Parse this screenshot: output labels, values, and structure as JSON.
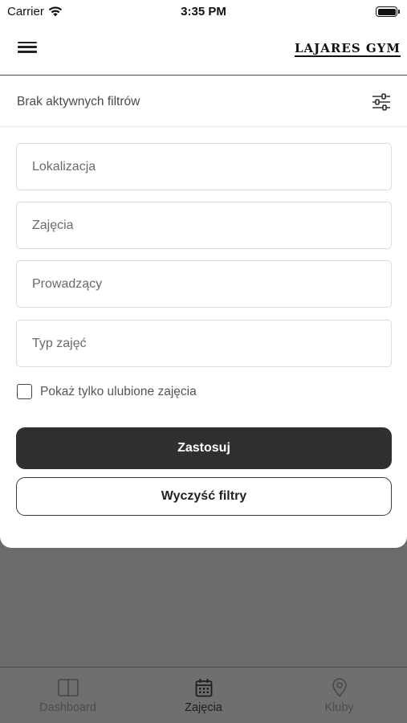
{
  "status_bar": {
    "carrier": "Carrier",
    "time": "3:35 PM",
    "battery_level": 1.0
  },
  "nav": {
    "menu_icon": "hamburger-menu-icon",
    "brand": "LAJARES GYM"
  },
  "filters": {
    "status": "Brak aktywnych filtrów",
    "toggle_icon": "sliders-icon",
    "fields": {
      "location": "Lokalizacja",
      "class": "Zajęcia",
      "instructor": "Prowadzący",
      "class_type": "Typ zajęć"
    },
    "favorites_only": {
      "label": "Pokaż tylko ulubione zajęcia",
      "checked": false
    },
    "apply_label": "Zastosuj",
    "clear_label": "Wyczyść filtry"
  },
  "tabs": [
    {
      "label": "Dashboard",
      "icon": "dashboard-icon",
      "active": false
    },
    {
      "label": "Zajęcia",
      "icon": "calendar-icon",
      "active": true
    },
    {
      "label": "Kluby",
      "icon": "location-pin-icon",
      "active": false
    }
  ],
  "colors": {
    "overlay": "#6b6b6b",
    "primary_button": "#303030",
    "sheet": "#ffffff"
  }
}
